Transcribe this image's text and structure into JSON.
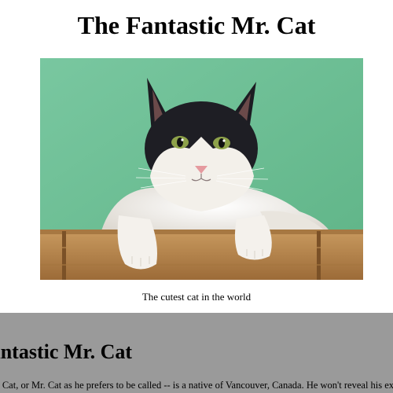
{
  "page": {
    "title": "The Fantastic Mr. Cat"
  },
  "figure": {
    "caption": "The cutest cat in the world",
    "colors": {
      "wall": "#6dbf93",
      "shelf": "#b4824a",
      "fur_dark": "#1e1e24",
      "fur_light": "#f2efea"
    }
  },
  "section": {
    "title": "The Fantastic Mr. Cat",
    "body": "Mr. Cat, or Mr. Cat as he prefers to be called -- is a native of Vancouver, Canada. He won't reveal his exact age, but",
    "background": "#9a9a9a"
  }
}
